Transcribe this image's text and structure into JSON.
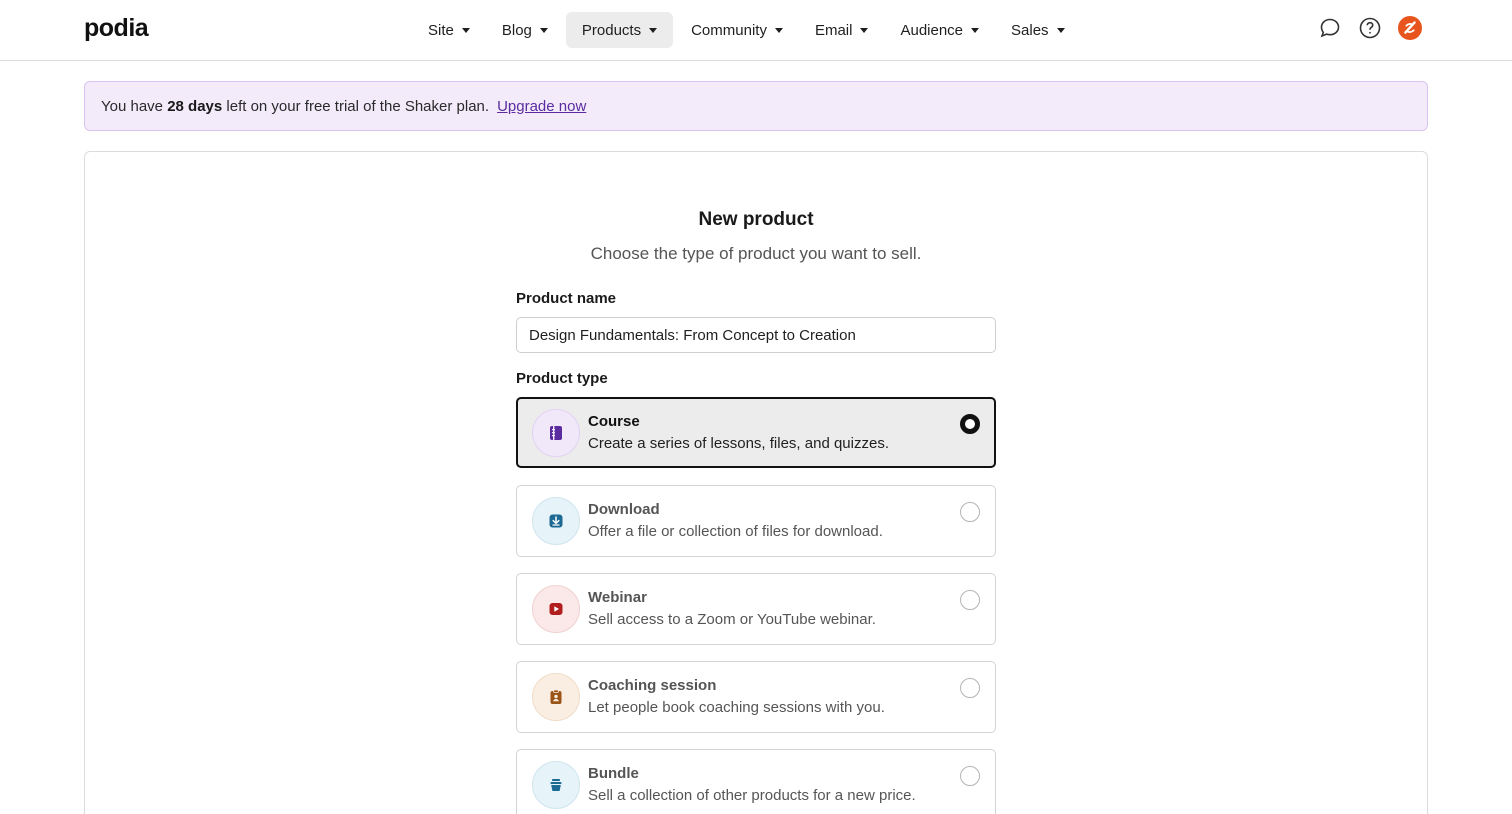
{
  "brand": {
    "logo": "podia"
  },
  "nav": {
    "items": [
      {
        "label": "Site"
      },
      {
        "label": "Blog"
      },
      {
        "label": "Products",
        "active": true
      },
      {
        "label": "Community"
      },
      {
        "label": "Email"
      },
      {
        "label": "Audience"
      },
      {
        "label": "Sales"
      }
    ],
    "icons": [
      "chat-icon",
      "help-icon",
      "avatar"
    ]
  },
  "banner": {
    "prefix": "You have",
    "days": "28 days",
    "suffix": "left on your free trial of the Shaker plan.",
    "link": "Upgrade now",
    "colors": {
      "background": "#f3ebfa",
      "border": "#d9c4ef",
      "link": "#5b2ca0"
    }
  },
  "form": {
    "title": "New product",
    "subtitle": "Choose the type of product you want to sell.",
    "name_label": "Product name",
    "name_value": "Design Fundamentals: From Concept to Creation",
    "type_label": "Product type",
    "types": [
      {
        "name": "Course",
        "description": "Create a series of lessons, files, and quizzes.",
        "selected": true,
        "icon": "course-icon",
        "color": "#5b2ca0",
        "tint": "#f1e9fa"
      },
      {
        "name": "Download",
        "description": "Offer a file or collection of files for download.",
        "selected": false,
        "icon": "download-icon",
        "color": "#1c6a93",
        "tint": "#e6f3f8"
      },
      {
        "name": "Webinar",
        "description": "Sell access to a Zoom or YouTube webinar.",
        "selected": false,
        "icon": "webinar-icon",
        "color": "#b01e1e",
        "tint": "#fbe9e9"
      },
      {
        "name": "Coaching session",
        "description": "Let people book coaching sessions with you.",
        "selected": false,
        "icon": "coaching-icon",
        "color": "#9a5416",
        "tint": "#faeee2"
      },
      {
        "name": "Bundle",
        "description": "Sell a collection of other products for a new price.",
        "selected": false,
        "icon": "bundle-icon",
        "color": "#1c6a93",
        "tint": "#e6f3f8"
      }
    ]
  }
}
